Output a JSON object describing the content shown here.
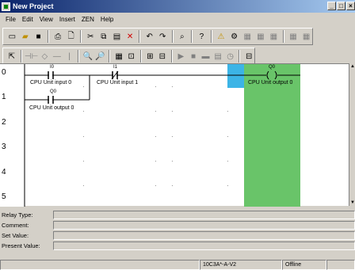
{
  "window": {
    "title": "New Project",
    "controls": [
      "_",
      "□",
      "×"
    ]
  },
  "menu": [
    "File",
    "Edit",
    "View",
    "Insert",
    "ZEN",
    "Help"
  ],
  "toolbar1": {
    "buttons": [
      "new-icon",
      "open-icon",
      "save-icon",
      "print-icon",
      "print-preview-icon",
      "cut-icon",
      "copy-icon",
      "paste-icon",
      "delete-icon",
      "undo-icon",
      "redo-icon",
      "find-icon",
      "help-icon",
      "warning-icon",
      "compile-icon",
      "disabled-1",
      "disabled-2",
      "disabled-3",
      "disabled-4",
      "disabled-5"
    ]
  },
  "toolbar2": {
    "buttons": [
      "select-icon",
      "contact-icon",
      "coil-icon",
      "line-h-icon",
      "line-v-icon",
      "zoom-in-icon",
      "zoom-out-icon",
      "grid-icon",
      "monitor-icon",
      "online-icon",
      "run-icon",
      "stop-icon",
      "program-icon",
      "mode-icon",
      "clock-icon",
      "io-icon"
    ]
  },
  "ladder": {
    "rows": [
      "0",
      "1",
      "2",
      "3",
      "4",
      "5"
    ],
    "contacts": [
      {
        "address": "I0",
        "comment": "CPU Unit input 0"
      },
      {
        "address": "I1",
        "comment": "CPU Unit input 1"
      },
      {
        "address": "Q0",
        "comment": "CPU Unit output 0"
      }
    ],
    "coil": {
      "address": "Q0",
      "comment": "CPU Unit output 0"
    }
  },
  "properties": {
    "relay_type": "Relay Type:",
    "comment": "Comment:",
    "set_value": "Set Value:",
    "present_value": "Present Value:"
  },
  "status": {
    "model": "10C3A*-A-V2",
    "mode": "Offline"
  }
}
